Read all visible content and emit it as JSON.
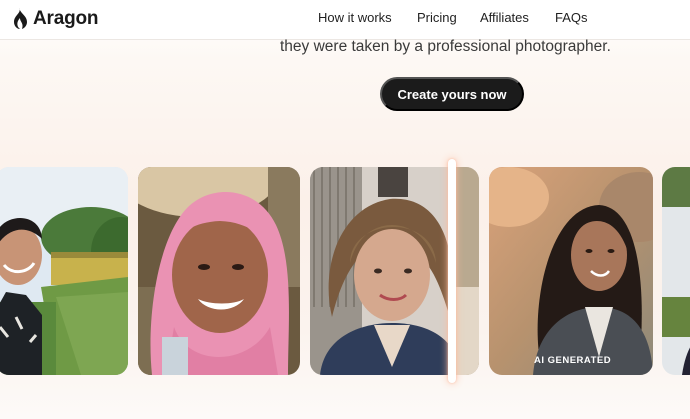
{
  "brand": {
    "name": "Aragon",
    "logo_icon": "flame-logo-icon"
  },
  "nav": {
    "links": [
      "How it works",
      "Pricing",
      "Affiliates",
      "FAQs"
    ]
  },
  "hero": {
    "subtitle": "they were taken by a professional photographer.",
    "cta_label": "Create yours now"
  },
  "gallery": {
    "ai_badge": "AI GENERATED"
  },
  "colors": {
    "accent_dark": "#1b1b1b",
    "divider_glow": "#ffc8b0",
    "page_tint": "#fbf0e9"
  }
}
